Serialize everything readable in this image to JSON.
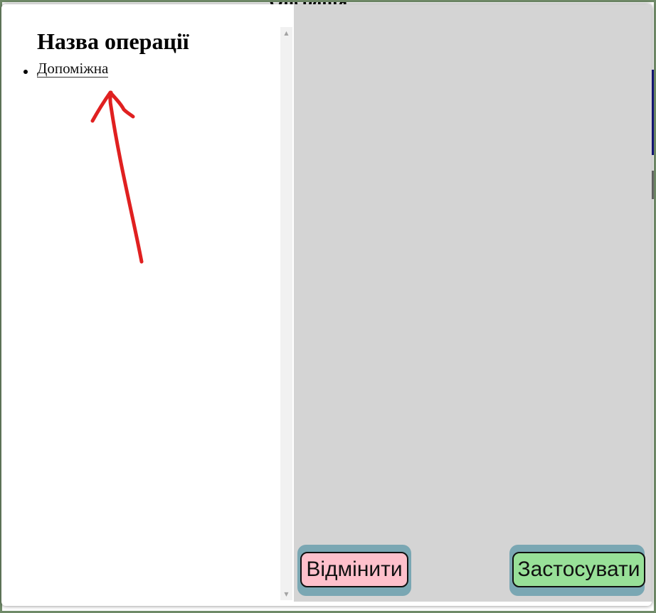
{
  "background": {
    "title": "Операція"
  },
  "modal": {
    "operation_heading": "Назва операції",
    "operation_items": [
      "Допоміжна"
    ],
    "cancel_label": "Відмінити",
    "apply_label": "Застосувати"
  },
  "colors": {
    "cancel_bg": "#ffc0cb",
    "apply_bg": "#98e098",
    "button_halo": "#7aa7b3",
    "annotation_arrow": "#e02020",
    "right_panel_bg": "#d4d4d4"
  },
  "icons": {
    "scroll_up": "scroll-up-arrow-icon",
    "scroll_down": "scroll-down-arrow-icon",
    "annotation": "red-arrow-annotation-icon"
  }
}
